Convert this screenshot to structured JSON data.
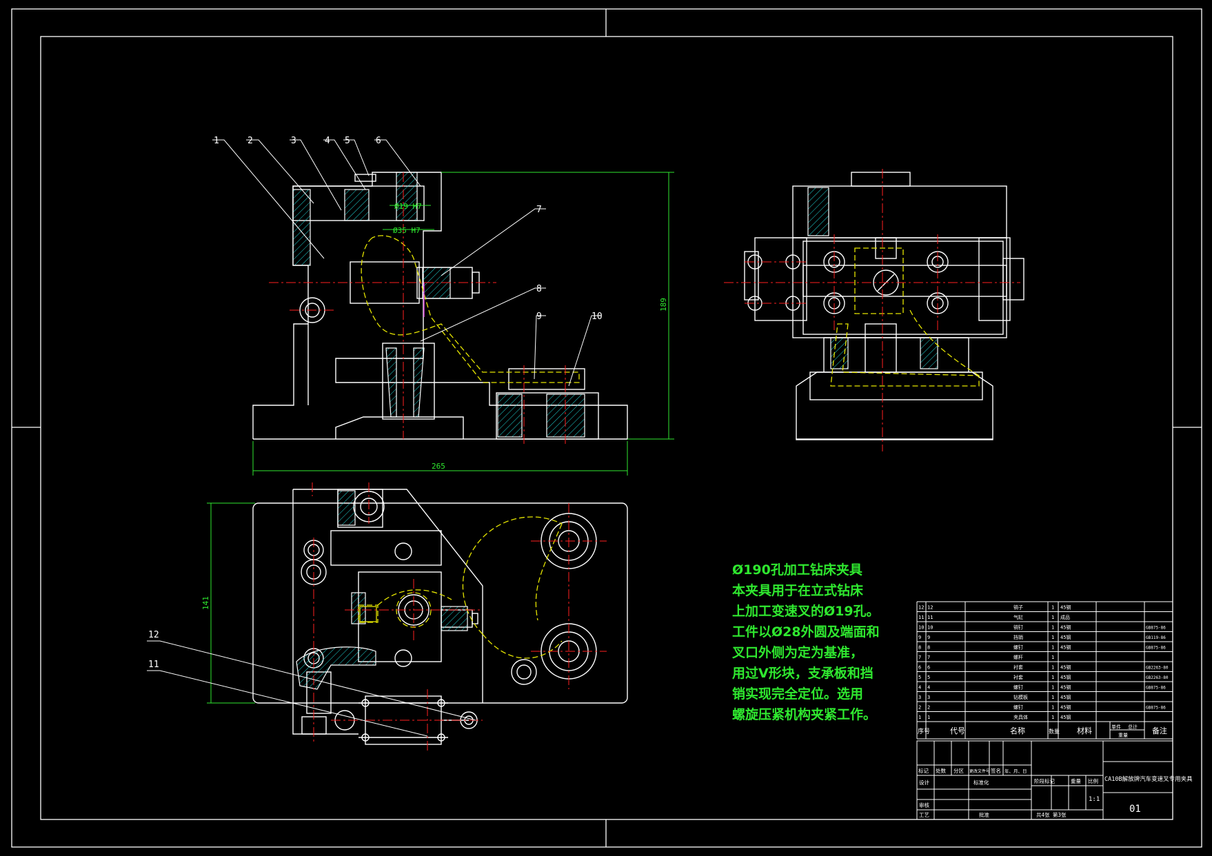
{
  "balloons": [
    "1",
    "2",
    "3",
    "4",
    "5",
    "6",
    "7",
    "8",
    "9",
    "10",
    "11",
    "12"
  ],
  "dimensions": {
    "bore": "Ø19 H7",
    "outer": "Ø35 H7",
    "width": "265",
    "height": "189",
    "plan_height": "141"
  },
  "notes": [
    "Ø190孔加工钻床夹具",
    "本夹具用于在立式钻床",
    "上加工变速叉的Ø19孔。",
    "工件以Ø28外圆及端面和",
    "叉口外侧为定为基准，",
    "用过V形块，支承板和挡",
    "销实现完全定位。选用",
    "螺旋压紧机构夹紧工作。"
  ],
  "bom": {
    "headers": [
      "序号",
      "代号",
      "名称",
      "数量",
      "材料",
      "单件",
      "总计",
      "备注"
    ],
    "weight_label": "重量",
    "rows": [
      {
        "no": "12",
        "code": "12",
        "name": "销子",
        "qty": "1",
        "mat": "45钢",
        "note": ""
      },
      {
        "no": "11",
        "code": "11",
        "name": "气缸",
        "qty": "1",
        "mat": "成品",
        "note": ""
      },
      {
        "no": "10",
        "code": "10",
        "name": "销钉",
        "qty": "1",
        "mat": "45钢",
        "note": "GB875-86"
      },
      {
        "no": "9",
        "code": "9",
        "name": "挡销",
        "qty": "1",
        "mat": "45钢",
        "note": "GB119-86"
      },
      {
        "no": "8",
        "code": "8",
        "name": "螺钉",
        "qty": "1",
        "mat": "45钢",
        "note": "GB875-86"
      },
      {
        "no": "7",
        "code": "7",
        "name": "螺杆",
        "qty": "1",
        "mat": "",
        "note": ""
      },
      {
        "no": "6",
        "code": "6",
        "name": "衬套",
        "qty": "1",
        "mat": "45钢",
        "note": "GB2263-80"
      },
      {
        "no": "5",
        "code": "5",
        "name": "衬套",
        "qty": "1",
        "mat": "45钢",
        "note": "GB2263-80"
      },
      {
        "no": "4",
        "code": "4",
        "name": "螺钉",
        "qty": "1",
        "mat": "45钢",
        "note": "GB875-86"
      },
      {
        "no": "3",
        "code": "3",
        "name": "钻模板",
        "qty": "1",
        "mat": "45钢",
        "note": ""
      },
      {
        "no": "2",
        "code": "2",
        "name": "螺钉",
        "qty": "1",
        "mat": "45钢",
        "note": "GB875-86"
      },
      {
        "no": "1",
        "code": "1",
        "name": "夹具体",
        "qty": "1",
        "mat": "45钢",
        "note": ""
      }
    ]
  },
  "title_block": {
    "title": "CA10B解放牌汽车变速叉专用夹具",
    "row_labels": [
      "标记",
      "处数",
      "分区",
      "更改文件号",
      "签名",
      "年、月、日"
    ],
    "design": "设计",
    "standard": "标准化",
    "stage": "阶段标记",
    "weight": "重量",
    "scale_label": "比例",
    "scale": "1:1",
    "review": "审核",
    "process": "工艺",
    "approve": "批准",
    "sheets": "共4张  第3张",
    "drawing_no": "01"
  },
  "colors": {
    "line": "#ffffff",
    "center": "#ff2020",
    "dim": "#2fe82f",
    "hatch": "#1ec8c8",
    "phantom": "#e6e600",
    "magenta": "#d040d0"
  }
}
